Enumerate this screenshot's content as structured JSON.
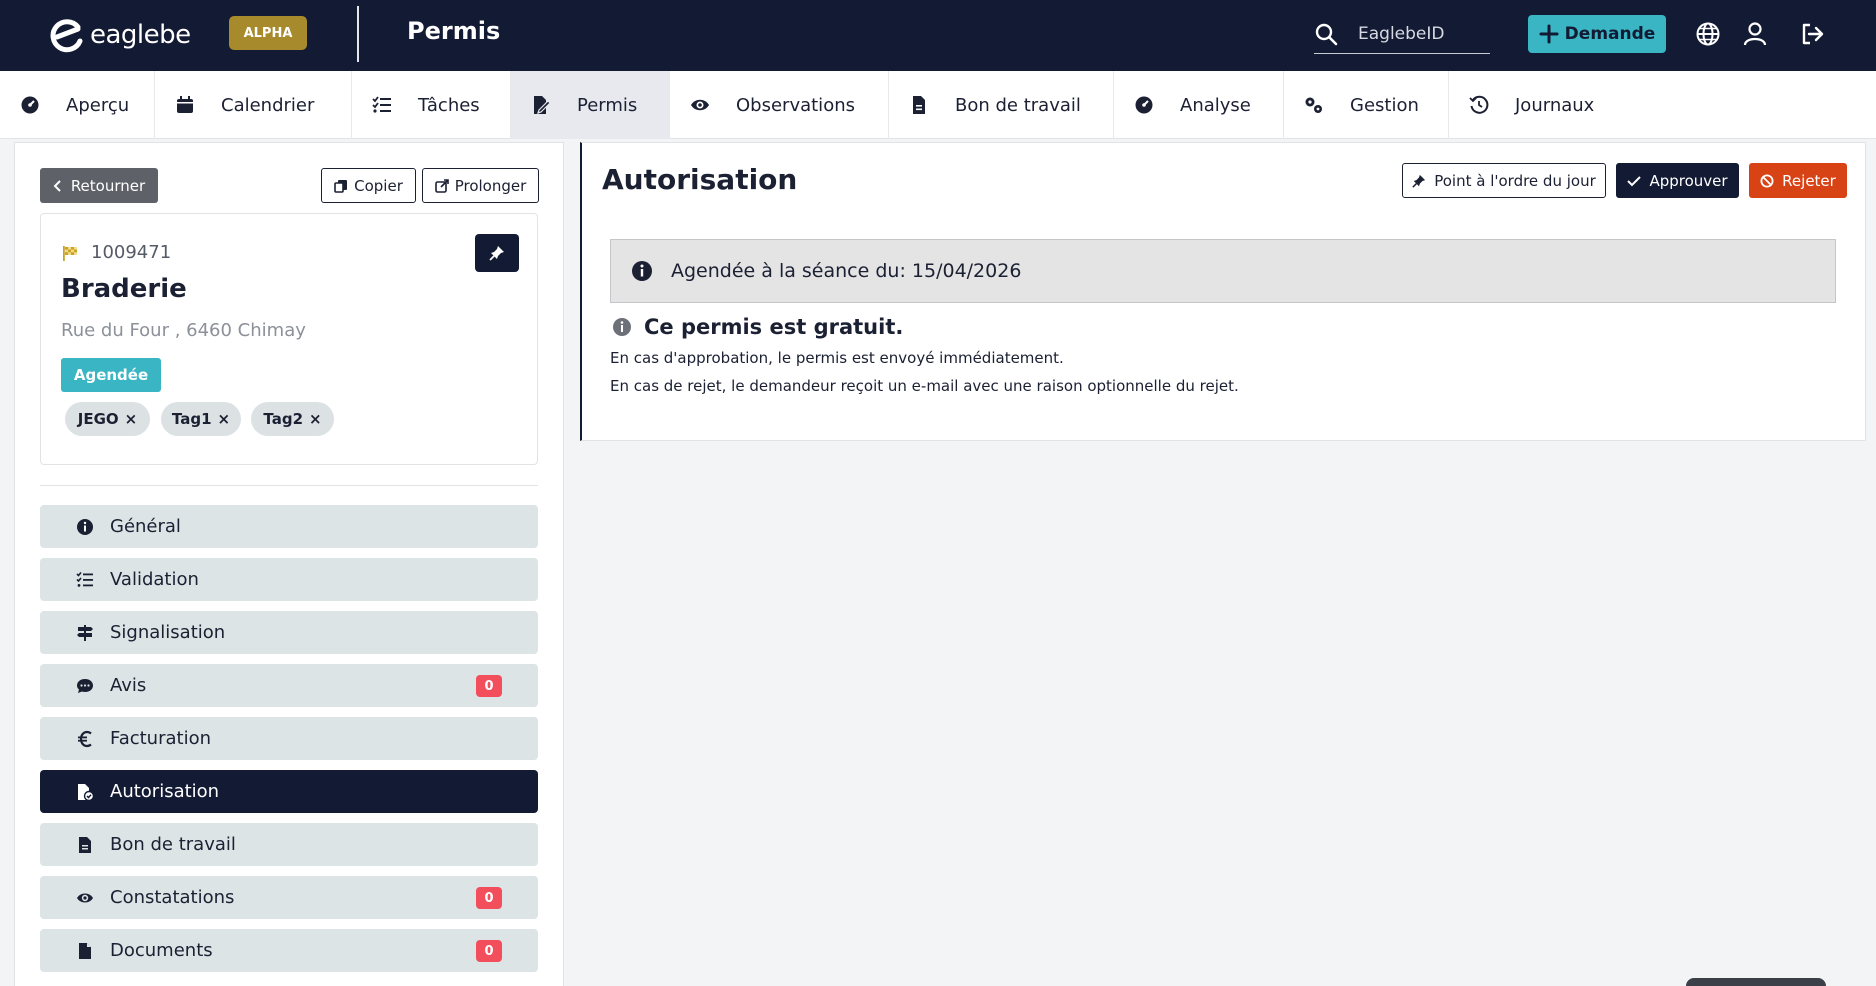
{
  "header": {
    "logo_text": "eaglebe",
    "badge": "ALPHA",
    "app_title": "Permis",
    "search_placeholder": "EaglebeID",
    "new_request_label": "Demande"
  },
  "nav": {
    "tabs": [
      {
        "label": "Aperçu",
        "icon": "dashboard-icon"
      },
      {
        "label": "Calendrier",
        "icon": "calendar-icon"
      },
      {
        "label": "Tâches",
        "icon": "tasks-icon"
      },
      {
        "label": "Permis",
        "icon": "permit-icon",
        "active": true
      },
      {
        "label": "Observations",
        "icon": "eye-icon"
      },
      {
        "label": "Bon de travail",
        "icon": "file-icon"
      },
      {
        "label": "Analyse",
        "icon": "gauge-icon"
      },
      {
        "label": "Gestion",
        "icon": "gears-icon"
      },
      {
        "label": "Journaux",
        "icon": "history-icon"
      }
    ]
  },
  "sidebar": {
    "back_label": "Retourner",
    "copy_label": "Copier",
    "extend_label": "Prolonger",
    "permit": {
      "number": "1009471",
      "name": "Braderie",
      "address": "Rue du Four , 6460 Chimay",
      "status": "Agendée",
      "tags": [
        "JEGO",
        "Tag1",
        "Tag2"
      ]
    },
    "menu": [
      {
        "label": "Général",
        "icon": "info-icon"
      },
      {
        "label": "Validation",
        "icon": "checklist-icon"
      },
      {
        "label": "Signalisation",
        "icon": "signpost-icon"
      },
      {
        "label": "Avis",
        "icon": "comment-icon",
        "count": "0"
      },
      {
        "label": "Facturation",
        "icon": "euro-icon"
      },
      {
        "label": "Autorisation",
        "icon": "file-check-icon",
        "active": true
      },
      {
        "label": "Bon de travail",
        "icon": "file-icon"
      },
      {
        "label": "Constatations",
        "icon": "eye-icon",
        "count": "0"
      },
      {
        "label": "Documents",
        "icon": "document-icon",
        "count": "0"
      }
    ]
  },
  "main": {
    "title": "Autorisation",
    "agenda_button": "Point à l'ordre du jour",
    "approve_button": "Approuver",
    "reject_button": "Rejeter",
    "info_box": "Agendée à la séance du: 15/04/2026",
    "notice_title": "Ce permis est gratuit.",
    "note_approval": "En cas d'approbation, le permis est envoyé immédiatement.",
    "note_reject": "En cas de rejet, le demandeur reçoit un e-mail avec une raison optionnelle du rejet."
  },
  "colors": {
    "navy": "#131a33",
    "teal": "#3ab5c4",
    "gold": "#a68a2b",
    "danger": "#d84315",
    "badge_red": "#f24e5b"
  }
}
